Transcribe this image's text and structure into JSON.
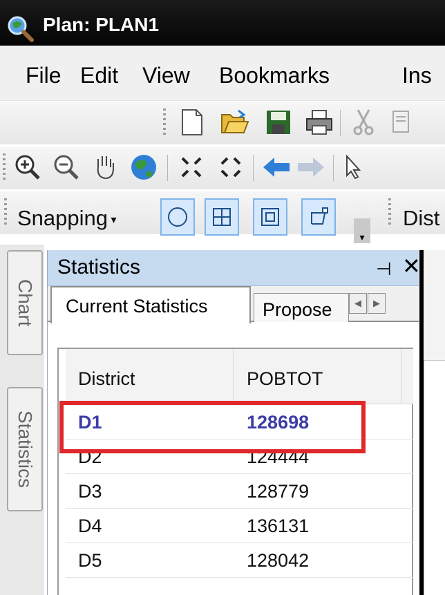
{
  "window": {
    "title": "Plan: PLAN1"
  },
  "menu": [
    "File",
    "Edit",
    "View",
    "Bookmarks",
    "Ins"
  ],
  "snapping_toolbar": {
    "label": "Snapping",
    "next_label": "Dist"
  },
  "side_tabs": [
    "Chart",
    "Statistics"
  ],
  "statistics_panel": {
    "title": "Statistics",
    "tabs": [
      "Current Statistics",
      "Propose"
    ],
    "columns": [
      "District",
      "POBTOT"
    ],
    "rows": [
      {
        "district": "D1",
        "pobtot": "128698"
      },
      {
        "district": "D2",
        "pobtot": "124444"
      },
      {
        "district": "D3",
        "pobtot": "128779"
      },
      {
        "district": "D4",
        "pobtot": "136131"
      },
      {
        "district": "D5",
        "pobtot": "128042"
      }
    ],
    "selected_row": "D1"
  },
  "colors": {
    "highlight": "#e0282b",
    "panel_header": "#c6daf0",
    "selected_text": "#3d3da6"
  }
}
